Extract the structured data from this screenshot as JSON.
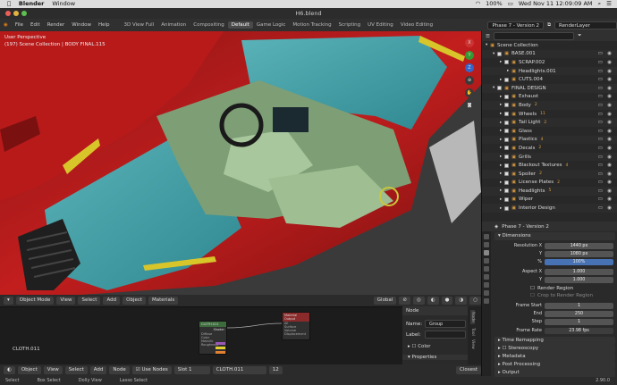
{
  "mac": {
    "app": "Blender",
    "menu_window": "Window",
    "battery": "100%",
    "clock": "Wed Nov 11  12:09:09 AM"
  },
  "window": {
    "title": "H6.blend"
  },
  "topmenu": {
    "items": [
      "File",
      "Edit",
      "Render",
      "Window",
      "Help"
    ],
    "workspaces": [
      "3D View Full",
      "Animation",
      "Compositing",
      "Default",
      "Game Logic",
      "Motion Tracking",
      "Scripting",
      "UV Editing",
      "Video Editing"
    ],
    "active_workspace": "Default",
    "scene": "Phase 7 - Version 2",
    "view_layer": "RenderLayer"
  },
  "viewport": {
    "mode_line1": "User Perspective",
    "mode_line2": "(197) Scene Collection | BODY FINAL.115"
  },
  "vpheader": {
    "mode": "Object Mode",
    "view": "View",
    "select": "Select",
    "add": "Add",
    "object": "Object",
    "materials": "Materials",
    "transform": "Global"
  },
  "nodeeditor": {
    "label": "CLOTH.011",
    "node1_title": "CLOTH.011",
    "node2_title": "Material Output",
    "node1_out": "Shader",
    "node1_rows": [
      "Diffuse",
      "Color",
      "Metallic",
      "Roughness"
    ],
    "node2_rows": [
      "All",
      "Surface",
      "Volume",
      "Displacement"
    ]
  },
  "nodepanel": {
    "header": "Node",
    "name_label": "Name:",
    "name_value": "Group",
    "label_label": "Label:",
    "color": "Color",
    "properties": "Properties",
    "tabs": [
      "Node",
      "Tool",
      "View"
    ]
  },
  "bottombar": {
    "object": "Object",
    "view": "View",
    "select": "Select",
    "add": "Add",
    "node": "Node",
    "use_nodes": "Use Nodes",
    "slot": "Slot 1",
    "material": "CLOTH.011",
    "users": "12",
    "snap": "Closest"
  },
  "status": {
    "select": "Select",
    "box": "Box Select",
    "dolly": "Dolly View",
    "lasso": "Lasso Select",
    "version": "2.90.0"
  },
  "outliner": {
    "search": "",
    "rows": [
      {
        "name": "Scene Collection",
        "indent": 0,
        "check": false,
        "eye": false,
        "count": ""
      },
      {
        "name": "BASE.001",
        "indent": 1,
        "check": true,
        "eye": true,
        "count": ""
      },
      {
        "name": "SCRAP.002",
        "indent": 2,
        "check": true,
        "eye": true,
        "count": ""
      },
      {
        "name": "Headlights.001",
        "indent": 3,
        "check": false,
        "eye": true,
        "count": ""
      },
      {
        "name": "CUTS.004",
        "indent": 2,
        "check": true,
        "eye": true,
        "count": ""
      },
      {
        "name": "FINAL DESIGN",
        "indent": 1,
        "check": true,
        "eye": true,
        "count": ""
      },
      {
        "name": "Exhaust",
        "indent": 2,
        "check": true,
        "eye": true,
        "count": ""
      },
      {
        "name": "Body",
        "indent": 2,
        "check": true,
        "eye": true,
        "count": "2"
      },
      {
        "name": "Wheels",
        "indent": 2,
        "check": true,
        "eye": true,
        "count": "11"
      },
      {
        "name": "Tail Light",
        "indent": 2,
        "check": true,
        "eye": true,
        "count": "2"
      },
      {
        "name": "Glass",
        "indent": 2,
        "check": true,
        "eye": true,
        "count": ""
      },
      {
        "name": "Plastics",
        "indent": 2,
        "check": true,
        "eye": true,
        "count": "4"
      },
      {
        "name": "Decals",
        "indent": 2,
        "check": true,
        "eye": true,
        "count": "2"
      },
      {
        "name": "Grills",
        "indent": 2,
        "check": true,
        "eye": true,
        "count": ""
      },
      {
        "name": "Blackout Textures",
        "indent": 2,
        "check": true,
        "eye": true,
        "count": "4"
      },
      {
        "name": "Spoiler",
        "indent": 2,
        "check": true,
        "eye": true,
        "count": "2"
      },
      {
        "name": "License Plates",
        "indent": 2,
        "check": true,
        "eye": true,
        "count": "2"
      },
      {
        "name": "Headlights",
        "indent": 2,
        "check": true,
        "eye": true,
        "count": "5"
      },
      {
        "name": "Wiper",
        "indent": 2,
        "check": true,
        "eye": true,
        "count": ""
      },
      {
        "name": "Interior Design",
        "indent": 2,
        "check": true,
        "eye": true,
        "count": ""
      }
    ]
  },
  "props": {
    "scene": "Phase 7 - Version 2",
    "dimensions": "Dimensions",
    "resx_label": "Resolution X",
    "resx": "1440 px",
    "y_label": "Y",
    "resy": "1080 px",
    "pct_label": "%",
    "pct": "100%",
    "aspx_label": "Aspect X",
    "aspx": "1.000",
    "aspy_label": "Y",
    "aspy": "1.000",
    "render_region": "Render Region",
    "crop": "Crop to Render Region",
    "fstart_label": "Frame Start",
    "fstart": "1",
    "end_label": "End",
    "end": "250",
    "step_label": "Step",
    "step": "1",
    "fps_label": "Frame Rate",
    "fps": "23.98 fps",
    "sections": [
      "Time Remapping",
      "Stereoscopy",
      "Metadata",
      "Post Processing",
      "Output"
    ]
  }
}
